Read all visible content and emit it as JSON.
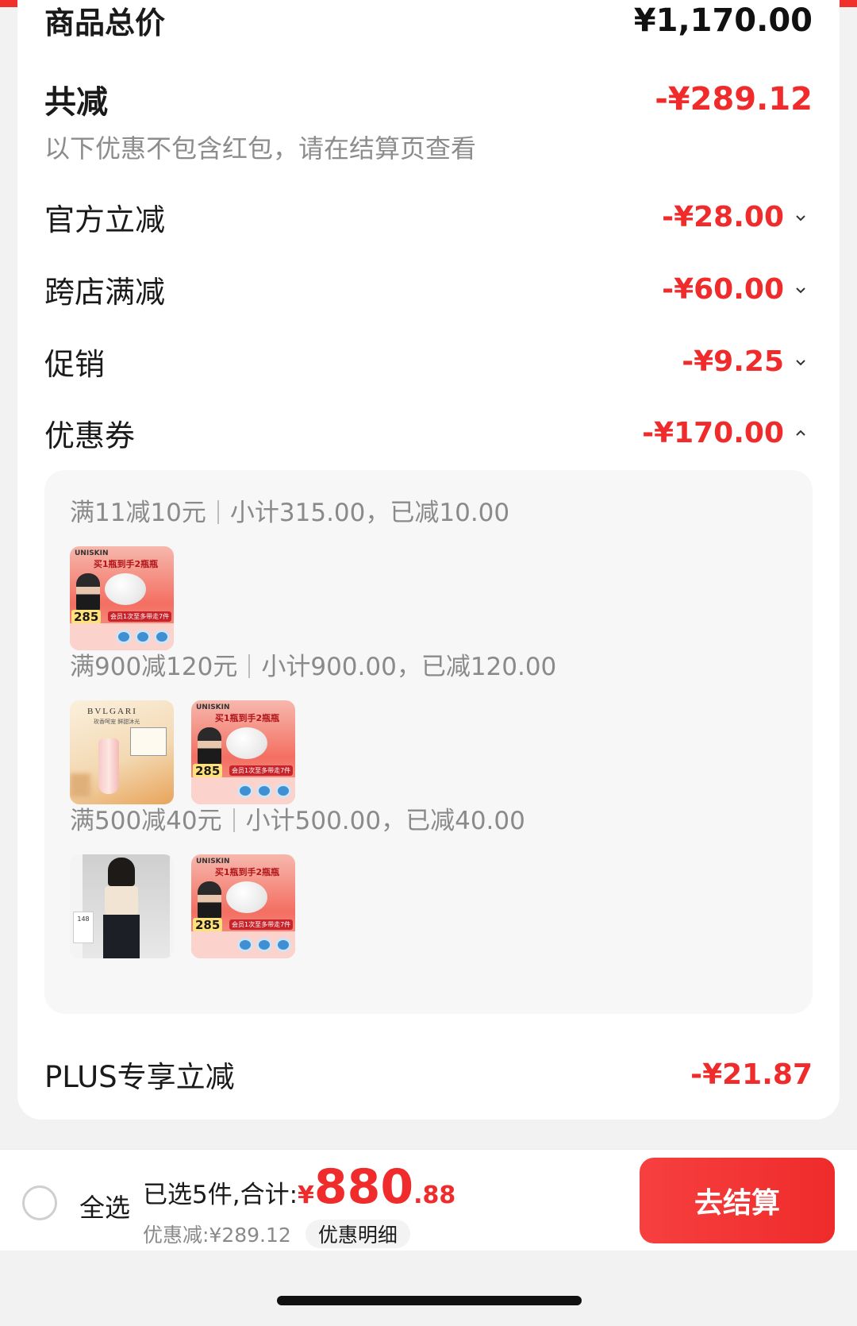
{
  "summary_card": {
    "total_label": "商品总价",
    "total_value": "¥1,170.00",
    "reduce_label": "共减",
    "reduce_value": "-¥289.12",
    "note": "以下优惠不包含红包，请在结算页查看",
    "items": [
      {
        "label": "官方立减",
        "value": "-¥28.00",
        "chevron": "chevron-down-icon"
      },
      {
        "label": "跨店满减",
        "value": "-¥60.00",
        "chevron": "chevron-down-icon"
      },
      {
        "label": "促销",
        "value": "-¥9.25",
        "chevron": "chevron-down-icon"
      },
      {
        "label": "优惠券",
        "value": "-¥170.00",
        "chevron": "chevron-up-icon"
      }
    ],
    "coupon_groups": [
      {
        "rule": "满11减10元",
        "subtotal": "小计315.00，已减10.00"
      },
      {
        "rule": "满900减120元",
        "subtotal": "小计900.00，已减120.00"
      },
      {
        "rule": "满500减40元",
        "subtotal": "小计500.00，已减40.00"
      }
    ],
    "product_thumbs": {
      "unisk_brand": "UNISKIN",
      "unisk_headline": "买1瓶到手2瓶瓶",
      "unisk_price": "285",
      "unisk_strip": "会员1次至多带走7件",
      "bvlgari_brand": "BVLGARI",
      "bvlgari_sub": "玫香呵宠 鲜甜沐光",
      "fashion_tag": "148"
    },
    "plus_label": "PLUS专享立减",
    "plus_value": "-¥21.87"
  },
  "footer": {
    "select_all": "全选",
    "selected_text": "已选5件,合计:",
    "currency": "¥",
    "total_integer": "880",
    "total_decimal": ".88",
    "discount_text": "优惠减:¥289.12",
    "detail_button": "优惠明细",
    "checkout_button": "去结算"
  },
  "colors": {
    "accent_red": "#ef2b2b",
    "background": "#f2f2f2",
    "coupon_box": "#f7f7f7"
  }
}
